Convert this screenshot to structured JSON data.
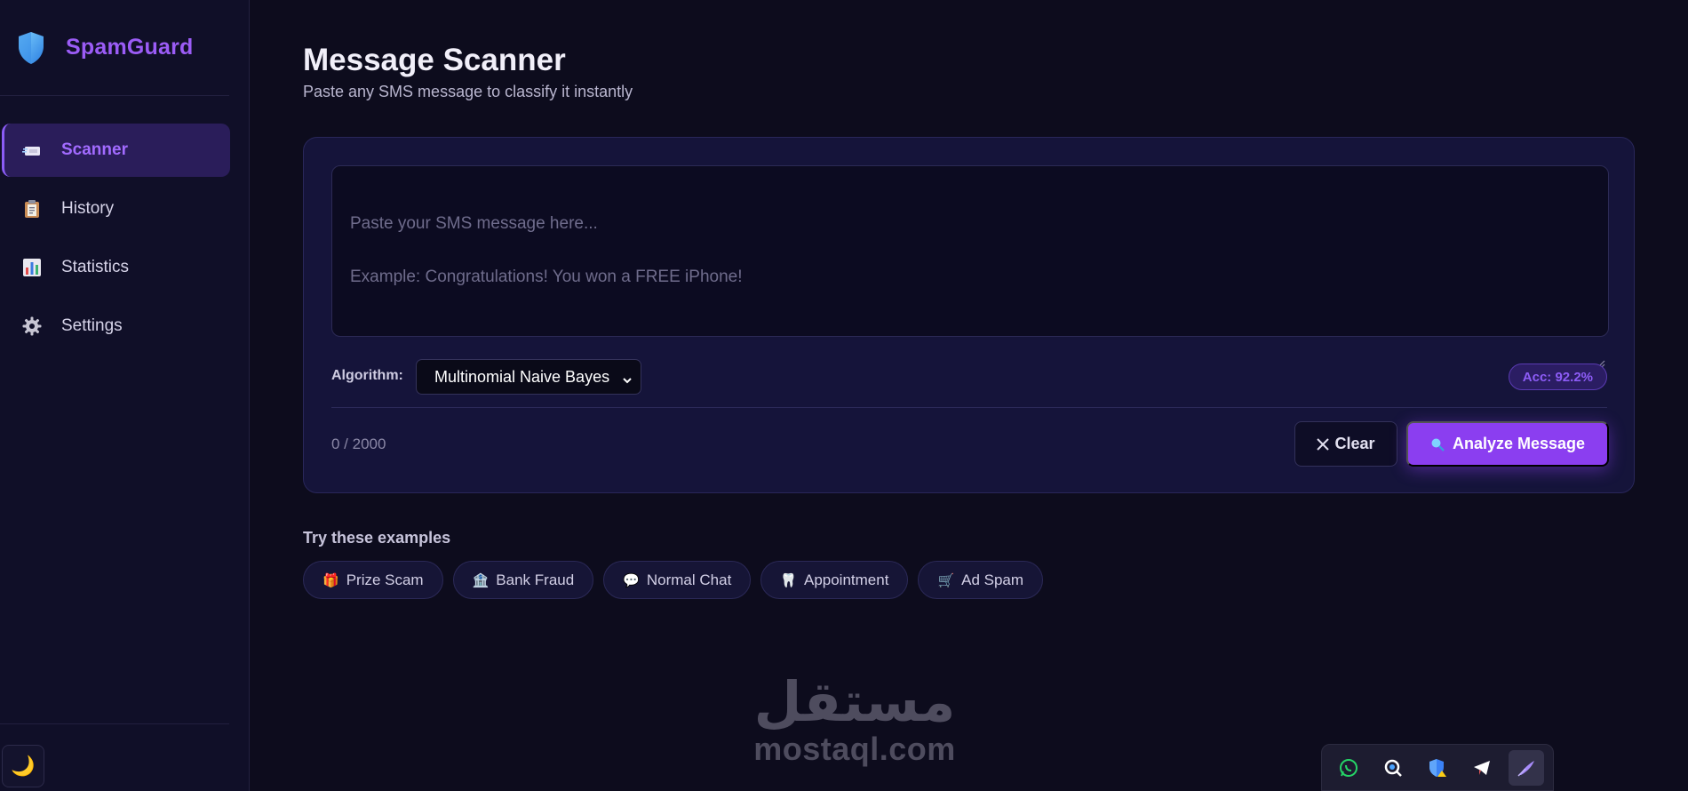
{
  "app": {
    "name": "SpamGuard"
  },
  "sidebar": {
    "items": [
      {
        "label": "Scanner",
        "icon": "inbox-icon",
        "active": true
      },
      {
        "label": "History",
        "icon": "clipboard-icon",
        "active": false
      },
      {
        "label": "Statistics",
        "icon": "bar-chart-icon",
        "active": false
      },
      {
        "label": "Settings",
        "icon": "gear-icon",
        "active": false
      }
    ],
    "theme_toggle_icon": "🌙"
  },
  "header": {
    "title": "Message Scanner",
    "subtitle": "Paste any SMS message to classify it instantly"
  },
  "scanner": {
    "message_value": "",
    "placeholder": "Paste your SMS message here...\n\nExample: Congratulations! You won a FREE iPhone!",
    "algorithm_label": "Algorithm:",
    "algorithm_selected": "Multinomial Naive Bayes",
    "accuracy_badge": "Acc: 92.2%",
    "char_count": "0 / 2000",
    "clear_label": "Clear",
    "analyze_label": "Analyze Message"
  },
  "examples": {
    "title": "Try these examples",
    "items": [
      {
        "label": "Prize Scam",
        "icon": "🎁"
      },
      {
        "label": "Bank Fraud",
        "icon": "🏦"
      },
      {
        "label": "Normal Chat",
        "icon": "💬"
      },
      {
        "label": "Appointment",
        "icon": "🦷"
      },
      {
        "label": "Ad Spam",
        "icon": "🛒"
      }
    ]
  },
  "watermark": {
    "arabic": "مستقل",
    "latin": "mostaql.com"
  },
  "colors": {
    "accent": "#8b3ef0",
    "brand": "#9b5cf6",
    "background": "#0d0c1d",
    "card": "#15143a"
  }
}
